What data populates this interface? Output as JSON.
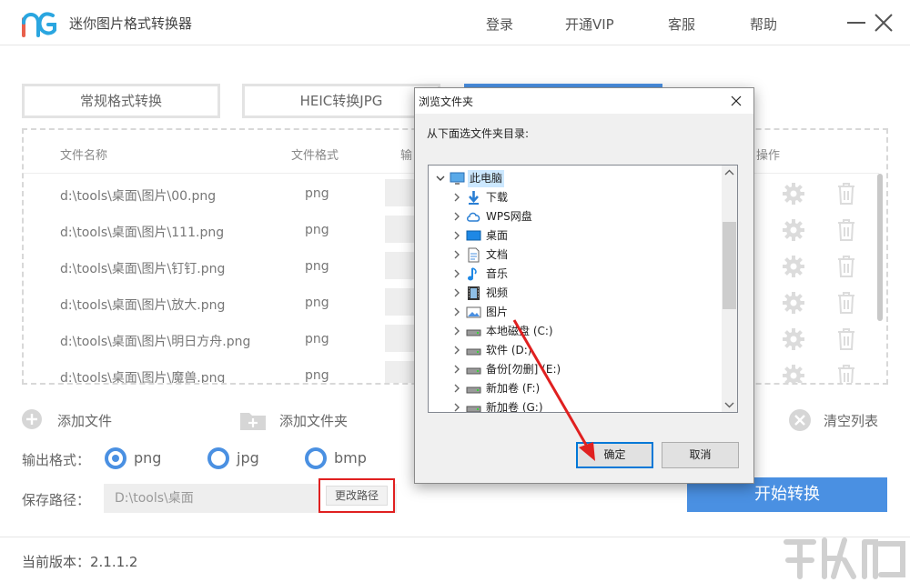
{
  "app": {
    "title": "迷你图片格式转换器",
    "nav": [
      "登录",
      "开通VIP",
      "客服",
      "帮助"
    ],
    "tabs": [
      "常规格式转换",
      "HEIC转换JPG"
    ],
    "colors": {
      "accent": "#4a90e2",
      "highlight": "#e02020"
    }
  },
  "table": {
    "columns": {
      "name": "文件名称",
      "format": "文件格式",
      "output": "输",
      "ops": "操作"
    },
    "rows": [
      {
        "name": "d:\\tools\\桌面\\图片\\00.png",
        "format": "png"
      },
      {
        "name": "d:\\tools\\桌面\\图片\\111.png",
        "format": "png"
      },
      {
        "name": "d:\\tools\\桌面\\图片\\钉钉.png",
        "format": "png"
      },
      {
        "name": "d:\\tools\\桌面\\图片\\放大.png",
        "format": "png"
      },
      {
        "name": "d:\\tools\\桌面\\图片\\明日方舟.png",
        "format": "png"
      },
      {
        "name": "d:\\tools\\桌面\\图片\\魔兽.png",
        "format": "png"
      }
    ]
  },
  "actions": {
    "add_file": "添加文件",
    "add_folder": "添加文件夹",
    "clear_list": "清空列表"
  },
  "output": {
    "label": "输出格式：",
    "options": [
      "png",
      "jpg",
      "bmp"
    ],
    "selected": "png"
  },
  "save": {
    "label": "保存路径：",
    "path": "D:\\tools\\桌面",
    "change_button": "更改路径"
  },
  "start_button": "开始转换",
  "footer": {
    "version": "当前版本：2.1.1.2"
  },
  "dialog": {
    "title": "浏览文件夹",
    "prompt": "从下面选文件夹目录:",
    "tree": [
      {
        "label": "此电脑",
        "icon": "computer-icon"
      },
      {
        "label": "下载",
        "icon": "download-icon"
      },
      {
        "label": "WPS网盘",
        "icon": "cloud-icon"
      },
      {
        "label": "桌面",
        "icon": "desktop-icon"
      },
      {
        "label": "文档",
        "icon": "document-icon"
      },
      {
        "label": "音乐",
        "icon": "music-icon"
      },
      {
        "label": "视频",
        "icon": "video-icon"
      },
      {
        "label": "图片",
        "icon": "picture-icon"
      },
      {
        "label": "本地磁盘 (C:)",
        "icon": "drive-icon"
      },
      {
        "label": "软件 (D:)",
        "icon": "drive-icon"
      },
      {
        "label": "备份[勿删] (E:)",
        "icon": "drive-icon"
      },
      {
        "label": "新加卷 (F:)",
        "icon": "drive-icon"
      },
      {
        "label": "新加卷 (G:)",
        "icon": "drive-icon"
      }
    ],
    "ok_button": "确定",
    "cancel_button": "取消"
  }
}
